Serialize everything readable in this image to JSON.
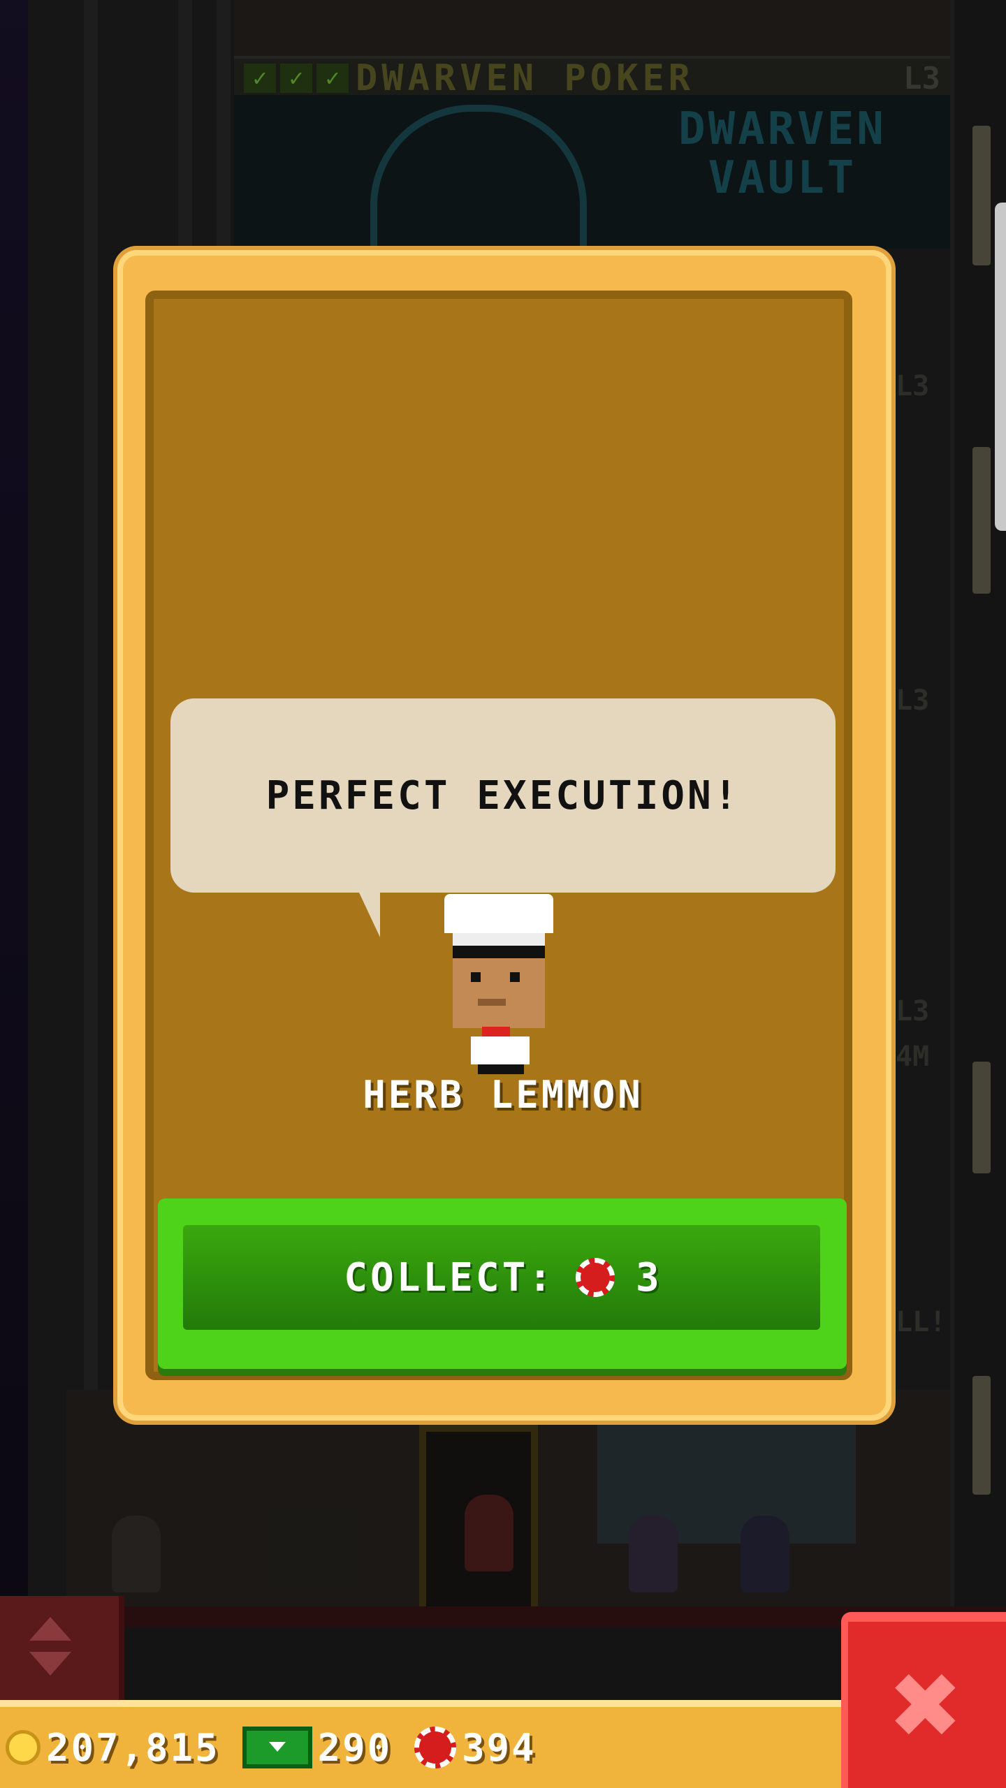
{
  "background": {
    "floor_name": "DWARVEN POKER",
    "floor_level": "L3",
    "vault_sign": "DWARVEN\nVAULT",
    "side_levels": [
      "L3",
      "L3",
      "L3",
      "L3"
    ],
    "side_partial": [
      "4M",
      "LL!"
    ]
  },
  "modal": {
    "speech": "PERFECT EXECUTION!",
    "character_name": "HERB LEMMON",
    "collect_label": "COLLECT:",
    "collect_icon": "chip-icon",
    "collect_amount": "3"
  },
  "resources": {
    "coins": "207,815",
    "bux": "290",
    "chips": "394"
  },
  "colors": {
    "modal_frame": "#f6b94e",
    "modal_inner": "#a87518",
    "collect_green": "#4fd21a",
    "close_red": "#e12a2a"
  },
  "icons": {
    "close": "close-icon",
    "coin": "coin-icon",
    "bux": "bux-icon",
    "chip": "chip-icon",
    "elevator": "elevator-arrows-icon"
  }
}
